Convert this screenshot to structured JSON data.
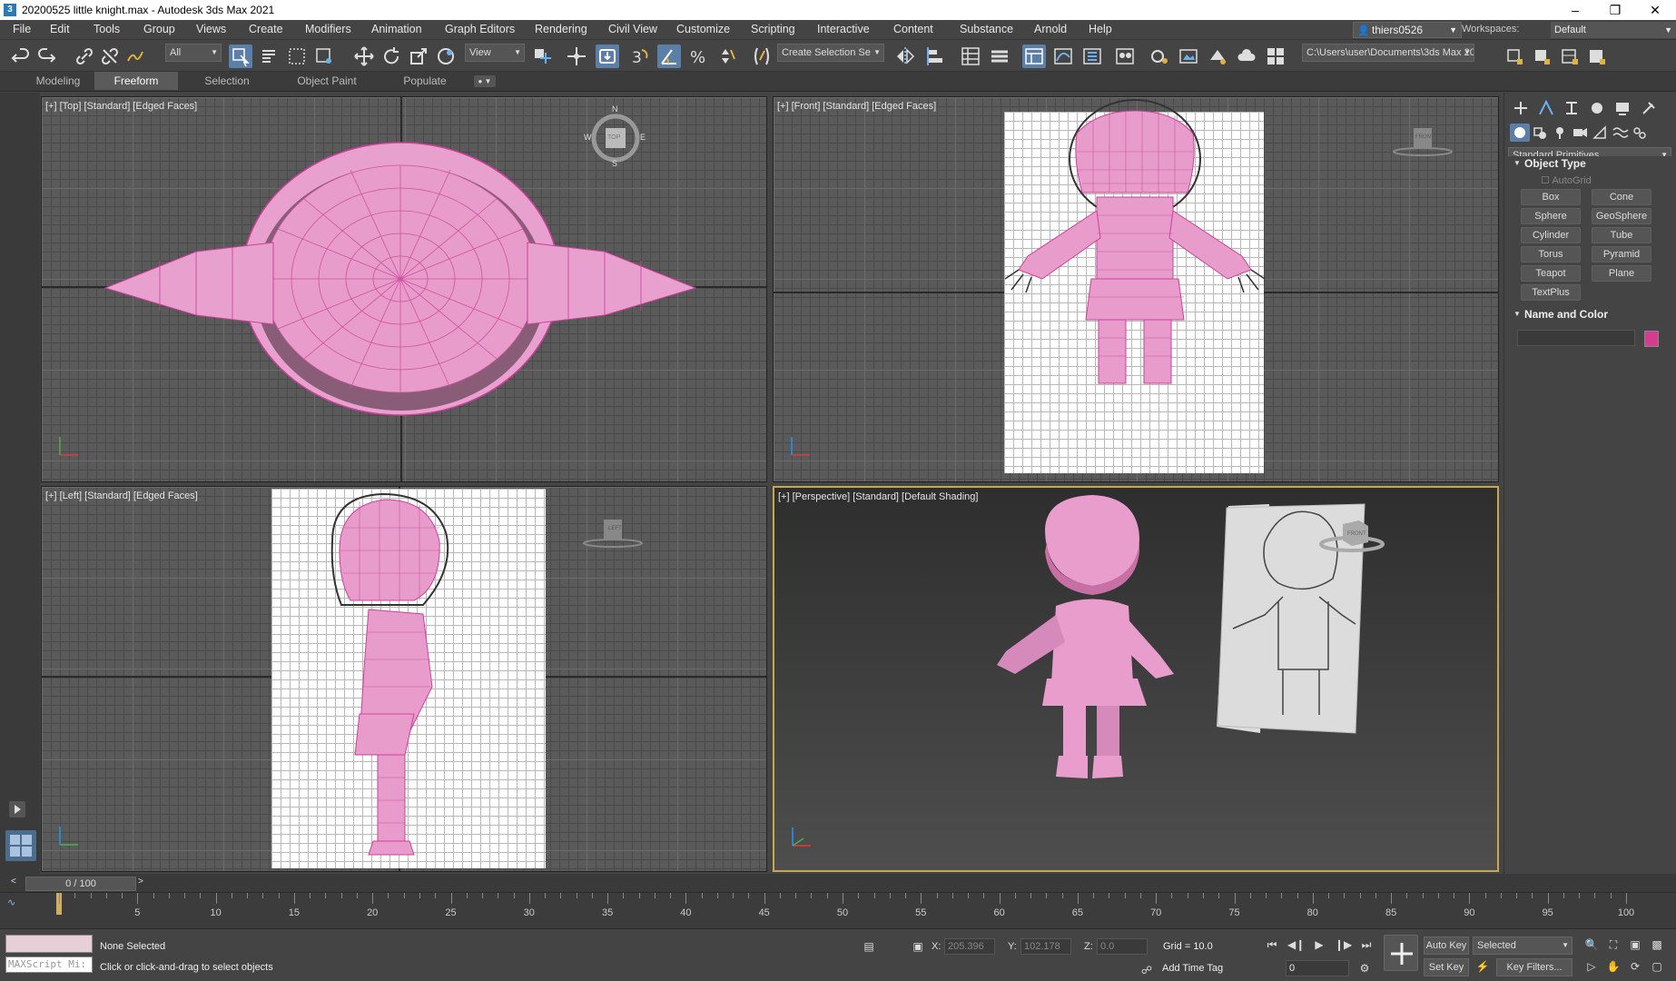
{
  "window": {
    "title": "20200525 little knight.max - Autodesk 3ds Max 2021",
    "app_icon": "3"
  },
  "menu": [
    "File",
    "Edit",
    "Tools",
    "Group",
    "Views",
    "Create",
    "Modifiers",
    "Animation",
    "Graph Editors",
    "Rendering",
    "Civil View",
    "Customize",
    "Scripting",
    "Interactive",
    "Content",
    "Substance",
    "Arnold",
    "Help"
  ],
  "user": {
    "name": "thiers0526"
  },
  "workspace": {
    "label": "Workspaces:",
    "value": "Default"
  },
  "toolbar": {
    "filter": "All",
    "refcoord": "View",
    "selection_set": "Create Selection Se",
    "path": "C:\\Users\\user\\Documents\\3ds Max 2021"
  },
  "ribbon": {
    "tabs": [
      "Modeling",
      "Freeform",
      "Selection",
      "Object Paint",
      "Populate"
    ],
    "active": "Freeform"
  },
  "viewports": {
    "top": {
      "label": "[+] [Top] [Standard] [Edged Faces]",
      "compass": {
        "n": "N",
        "s": "S",
        "e": "E",
        "w": "W",
        "cube": "TOP"
      }
    },
    "front": {
      "label": "[+] [Front] [Standard] [Edged Faces]",
      "cube": "FRONT"
    },
    "left": {
      "label": "[+] [Left] [Standard] [Edged Faces]",
      "cube": "LEFT"
    },
    "perspective": {
      "label": "[+] [Perspective] [Standard] [Default Shading]",
      "cube": "FRONT"
    }
  },
  "command_panel": {
    "category": "Standard Primitives",
    "object_type": {
      "title": "Object Type",
      "autogrid": "AutoGrid",
      "buttons": [
        "Box",
        "Cone",
        "Sphere",
        "GeoSphere",
        "Cylinder",
        "Tube",
        "Torus",
        "Pyramid",
        "Teapot",
        "Plane",
        "TextPlus"
      ]
    },
    "name_color": {
      "title": "Name and Color",
      "swatch_color": "#d63c8e"
    }
  },
  "timeline": {
    "frame": "0 / 100",
    "ticks": [
      "5",
      "10",
      "15",
      "20",
      "25",
      "30",
      "35",
      "40",
      "45",
      "50",
      "55",
      "60",
      "65",
      "70",
      "75",
      "80",
      "85",
      "90",
      "95",
      "100"
    ]
  },
  "status": {
    "maxscript": "MAXScript Mi:",
    "selection": "None Selected",
    "prompt": "Click or click-and-drag to select objects",
    "x_label": "X:",
    "x": "205.396",
    "y_label": "Y:",
    "y": "102.178",
    "z_label": "Z:",
    "z": "0.0",
    "grid": "Grid = 10.0",
    "add_time_tag": "Add Time Tag",
    "auto_key": "Auto Key",
    "key_mode": "Selected",
    "set_key": "Set Key",
    "key_filters": "Key Filters...",
    "current_frame": "0"
  },
  "colors": {
    "accent": "#5b7fa6",
    "model": "#e08cc0",
    "active_border": "#c8a84a"
  }
}
